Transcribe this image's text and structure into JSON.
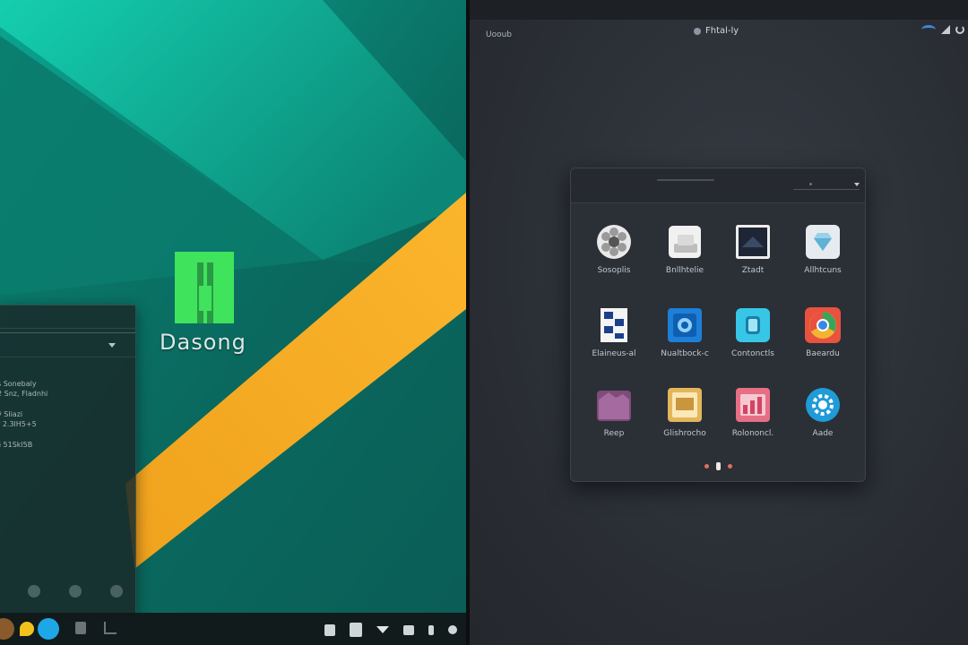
{
  "left": {
    "brand_name": "Dasong",
    "panel_lines": [
      "s Sonebaly",
      "2 Snz, Fladnhi",
      "ÿ Sliazi",
      "r 2.3lH5+5",
      "§ 51Skl5B"
    ]
  },
  "right": {
    "topbar": {
      "activities_label": "Uooub",
      "clock_label": "Fhtal-ly"
    },
    "drawer": {
      "apps": [
        {
          "label": "Sosoplis",
          "icon": "gear-flower-icon"
        },
        {
          "label": "Bnllhtelie",
          "icon": "document-stack-icon"
        },
        {
          "label": "Ztadt",
          "icon": "monitor-icon"
        },
        {
          "label": "Allhtcuns",
          "icon": "diamond-icon"
        },
        {
          "label": "Elaineus-al",
          "icon": "grid-document-icon"
        },
        {
          "label": "Nualtbock-c",
          "icon": "blue-photo-icon"
        },
        {
          "label": "Contonctls",
          "icon": "cyan-bag-icon"
        },
        {
          "label": "Baeardu",
          "icon": "chrome-circle-icon"
        },
        {
          "label": "Reep",
          "icon": "purple-folder-icon"
        },
        {
          "label": "Glishrocho",
          "icon": "gold-photo-icon"
        },
        {
          "label": "Rolononcl.",
          "icon": "pink-chart-icon"
        },
        {
          "label": "Aade",
          "icon": "blue-gear-icon"
        }
      ],
      "page_count": 3,
      "active_page": 2
    }
  },
  "colors": {
    "teal_dark": "#0f6a5e",
    "teal_light": "#12c9a8",
    "stripe_yellow": "#f6ad22",
    "logo_green": "#3fe35c",
    "drawer_bg": "#2b2f36",
    "page_dot": "#e0705f"
  }
}
